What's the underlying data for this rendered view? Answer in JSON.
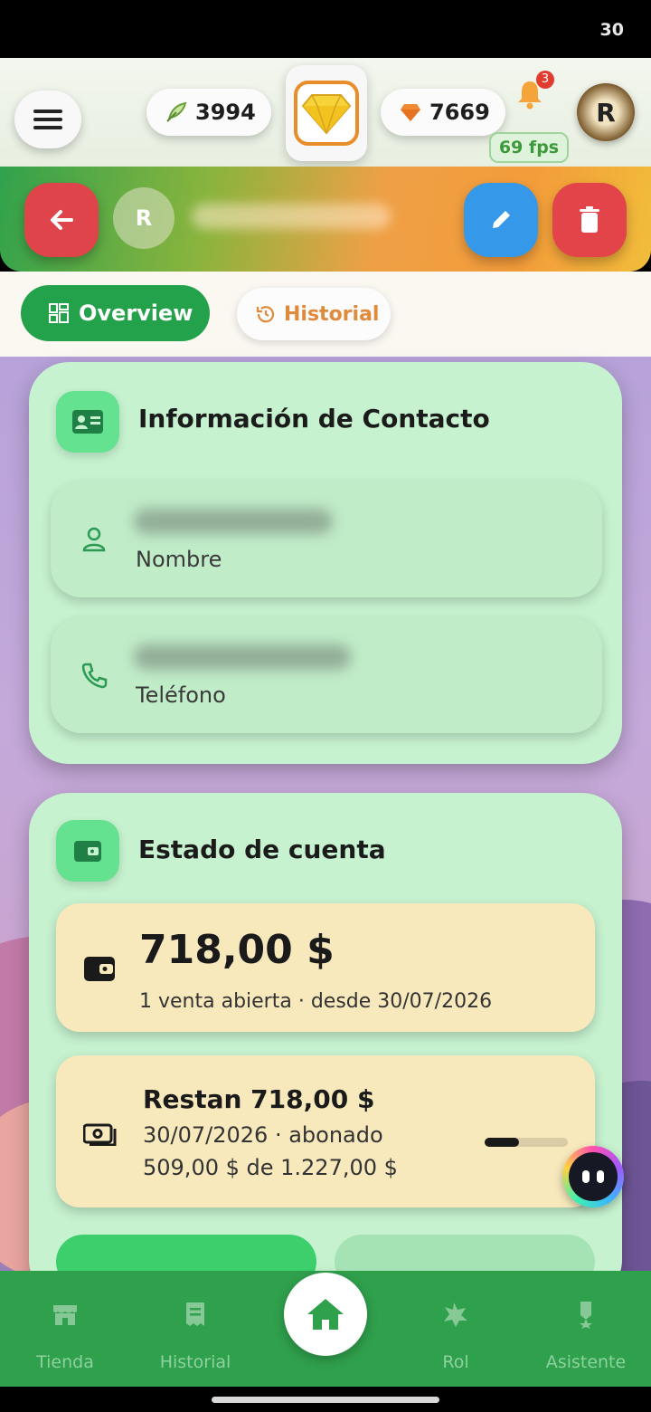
{
  "status_bar": {
    "time": "30"
  },
  "top_bar": {
    "feather_count": "3994",
    "gem_count": "7669",
    "notification_count": "3",
    "fps": "69 fps",
    "profile_initial": "R"
  },
  "header": {
    "avatar_initial": "R"
  },
  "tabs": {
    "overview": "Overview",
    "historial": "Historial"
  },
  "contact_card": {
    "title": "Información de Contacto",
    "name_label": "Nombre",
    "phone_label": "Teléfono"
  },
  "account_card": {
    "title": "Estado de cuenta",
    "balance": "718,00 $",
    "balance_sub": "1 venta abierta · desde 30/07/2026",
    "remaining": "Restan 718,00 $",
    "remaining_line1": "30/07/2026 · abonado",
    "remaining_line2": "509,00 $ de 1.227,00 $",
    "paid_progress": 0.415
  },
  "nav": {
    "items": [
      {
        "label": "Tienda",
        "icon": "store-icon"
      },
      {
        "label": "Historial",
        "icon": "receipt-icon"
      },
      {
        "label": "",
        "icon": "home-icon"
      },
      {
        "label": "Rol",
        "icon": "badge-icon"
      },
      {
        "label": "Asistente",
        "icon": "medal-icon"
      }
    ]
  },
  "colors": {
    "primary_green": "#24a14b",
    "accent_orange": "#e08a3c",
    "danger_red": "#e0444b",
    "edit_blue": "#3598e8"
  }
}
